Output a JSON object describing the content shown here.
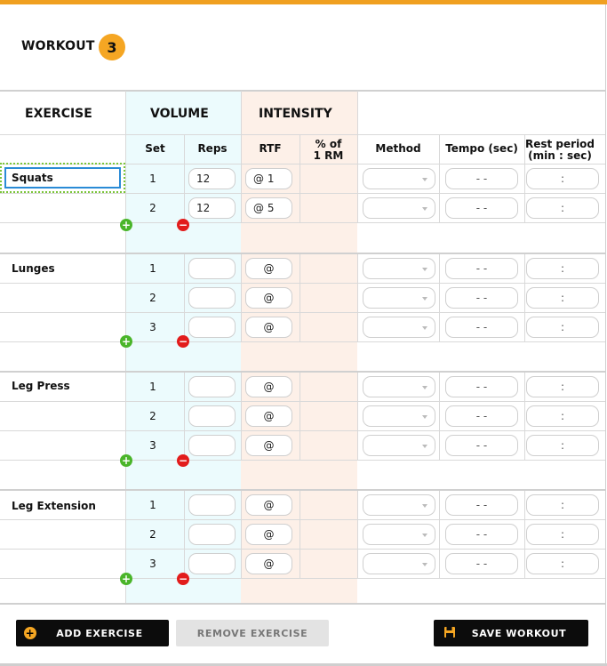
{
  "workout": {
    "label": "WORKOUT",
    "number": "3"
  },
  "headers": {
    "exercise": "EXERCISE",
    "volume": "VOLUME",
    "intensity": "INTENSITY",
    "set": "Set",
    "reps": "Reps",
    "rtf": "RTF",
    "pct_line1": "% of",
    "pct_line2": "1 RM",
    "method": "Method",
    "tempo": "Tempo (sec)",
    "rest_line1": "Rest period",
    "rest_line2": "(min : sec)"
  },
  "exercises": [
    {
      "name": "Squats",
      "editing": true,
      "sets": [
        {
          "set": "1",
          "reps": "12",
          "rtf": "@ 1"
        },
        {
          "set": "2",
          "reps": "12",
          "rtf": "@ 5"
        }
      ]
    },
    {
      "name": "Lunges",
      "sets": [
        {
          "set": "1",
          "reps": "",
          "rtf": "@"
        },
        {
          "set": "2",
          "reps": "",
          "rtf": "@"
        },
        {
          "set": "3",
          "reps": "",
          "rtf": "@"
        }
      ]
    },
    {
      "name": "Leg Press",
      "sets": [
        {
          "set": "1",
          "reps": "",
          "rtf": "@"
        },
        {
          "set": "2",
          "reps": "",
          "rtf": "@"
        },
        {
          "set": "3",
          "reps": "",
          "rtf": "@"
        }
      ]
    },
    {
      "name": "Leg Extension",
      "sets": [
        {
          "set": "1",
          "reps": "",
          "rtf": "@"
        },
        {
          "set": "2",
          "reps": "",
          "rtf": "@"
        },
        {
          "set": "3",
          "reps": "",
          "rtf": "@"
        }
      ]
    }
  ],
  "placeholders": {
    "tempo": "- -",
    "rest": ":"
  },
  "icons": {
    "add_set": "plus-circle-icon",
    "remove_set": "minus-circle-icon",
    "save": "floppy-disk-icon"
  },
  "buttons": {
    "add_exercise": "ADD EXERCISE",
    "remove_exercise": "REMOVE EXERCISE",
    "save_workout": "SAVE WORKOUT"
  },
  "colors": {
    "accent": "#f5a623",
    "add": "#4ab52a",
    "remove": "#e21c1c",
    "volume_bg": "#ecfbfd",
    "intensity_bg": "#fdf0e8",
    "focus": "#2a8bd6"
  }
}
